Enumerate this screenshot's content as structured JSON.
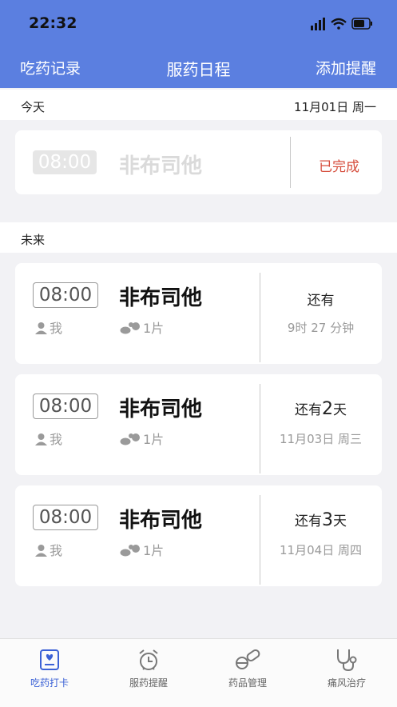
{
  "status_bar": {
    "time": "22:32"
  },
  "nav": {
    "left": "吃药记录",
    "title": "服药日程",
    "right": "添加提醒"
  },
  "colors": {
    "header": "#5b7fe0",
    "accent": "#3c62d6",
    "done": "#d64d3c"
  },
  "today": {
    "label": "今天",
    "date": "11月01日 周一",
    "item": {
      "time": "08:00",
      "drug": "非布司他",
      "status": "已完成"
    }
  },
  "future": {
    "label": "未来",
    "items": [
      {
        "time": "08:00",
        "drug": "非布司他",
        "person": "我",
        "dose": "1片",
        "remain_prefix": "还有",
        "remain_num": "",
        "remain_unit": "",
        "sub": "9时 27 分钟"
      },
      {
        "time": "08:00",
        "drug": "非布司他",
        "person": "我",
        "dose": "1片",
        "remain_prefix": "还有",
        "remain_num": "2",
        "remain_unit": "天",
        "sub": "11月03日 周三"
      },
      {
        "time": "08:00",
        "drug": "非布司他",
        "person": "我",
        "dose": "1片",
        "remain_prefix": "还有",
        "remain_num": "3",
        "remain_unit": "天",
        "sub": "11月04日 周四"
      }
    ]
  },
  "tabs": [
    {
      "label": "吃药打卡",
      "icon": "checkin-icon",
      "active": true
    },
    {
      "label": "服药提醒",
      "icon": "alarm-clock-icon",
      "active": false
    },
    {
      "label": "药品管理",
      "icon": "pill-icon",
      "active": false
    },
    {
      "label": "痛风治疗",
      "icon": "stethoscope-icon",
      "active": false
    }
  ]
}
